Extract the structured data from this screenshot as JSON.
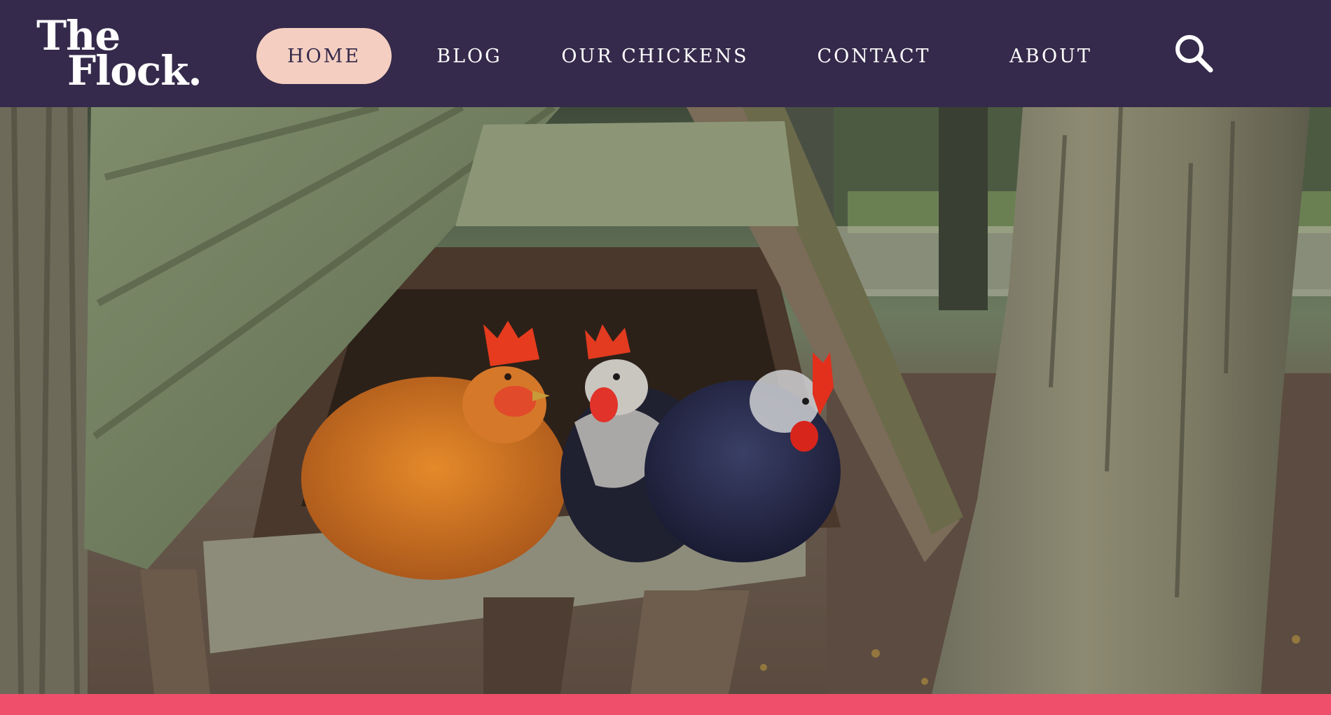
{
  "site": {
    "logo_line1": "The",
    "logo_line2": "Flock."
  },
  "nav": {
    "items": [
      {
        "label": "HOME",
        "active": true
      },
      {
        "label": "BLOG",
        "active": false
      },
      {
        "label": "OUR CHICKENS",
        "active": false
      },
      {
        "label": "CONTACT",
        "active": false
      },
      {
        "label": "ABOUT",
        "active": false
      }
    ],
    "search_icon": "search-icon"
  },
  "colors": {
    "header_bg": "#352a4b",
    "active_pill": "#f4cfc1",
    "nav_text": "#ffffff",
    "bottom_bar": "#ef4f6b"
  },
  "hero": {
    "subject": "hero-image-chickens-in-coop"
  }
}
